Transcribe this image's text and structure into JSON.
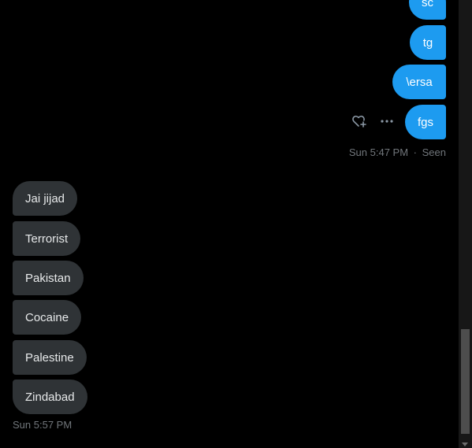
{
  "outgoing": [
    {
      "text": "sc"
    },
    {
      "text": "tg"
    },
    {
      "text": "\\ersa"
    },
    {
      "text": "fgs"
    }
  ],
  "outgoing_status": {
    "time": "Sun 5:47 PM",
    "separator": "·",
    "seen": "Seen"
  },
  "incoming": [
    {
      "text": "Jai jijad"
    },
    {
      "text": "Terrorist"
    },
    {
      "text": "Pakistan"
    },
    {
      "text": "Cocaine"
    },
    {
      "text": "Palestine"
    },
    {
      "text": "Zindabad"
    }
  ],
  "incoming_status": {
    "time": "Sun 5:57 PM"
  },
  "colors": {
    "outgoing_bubble": "#1d9bf0",
    "incoming_bubble": "#2f3336",
    "meta_text": "#71767b"
  },
  "icons": [
    "add-reaction-icon",
    "more-options-icon"
  ]
}
